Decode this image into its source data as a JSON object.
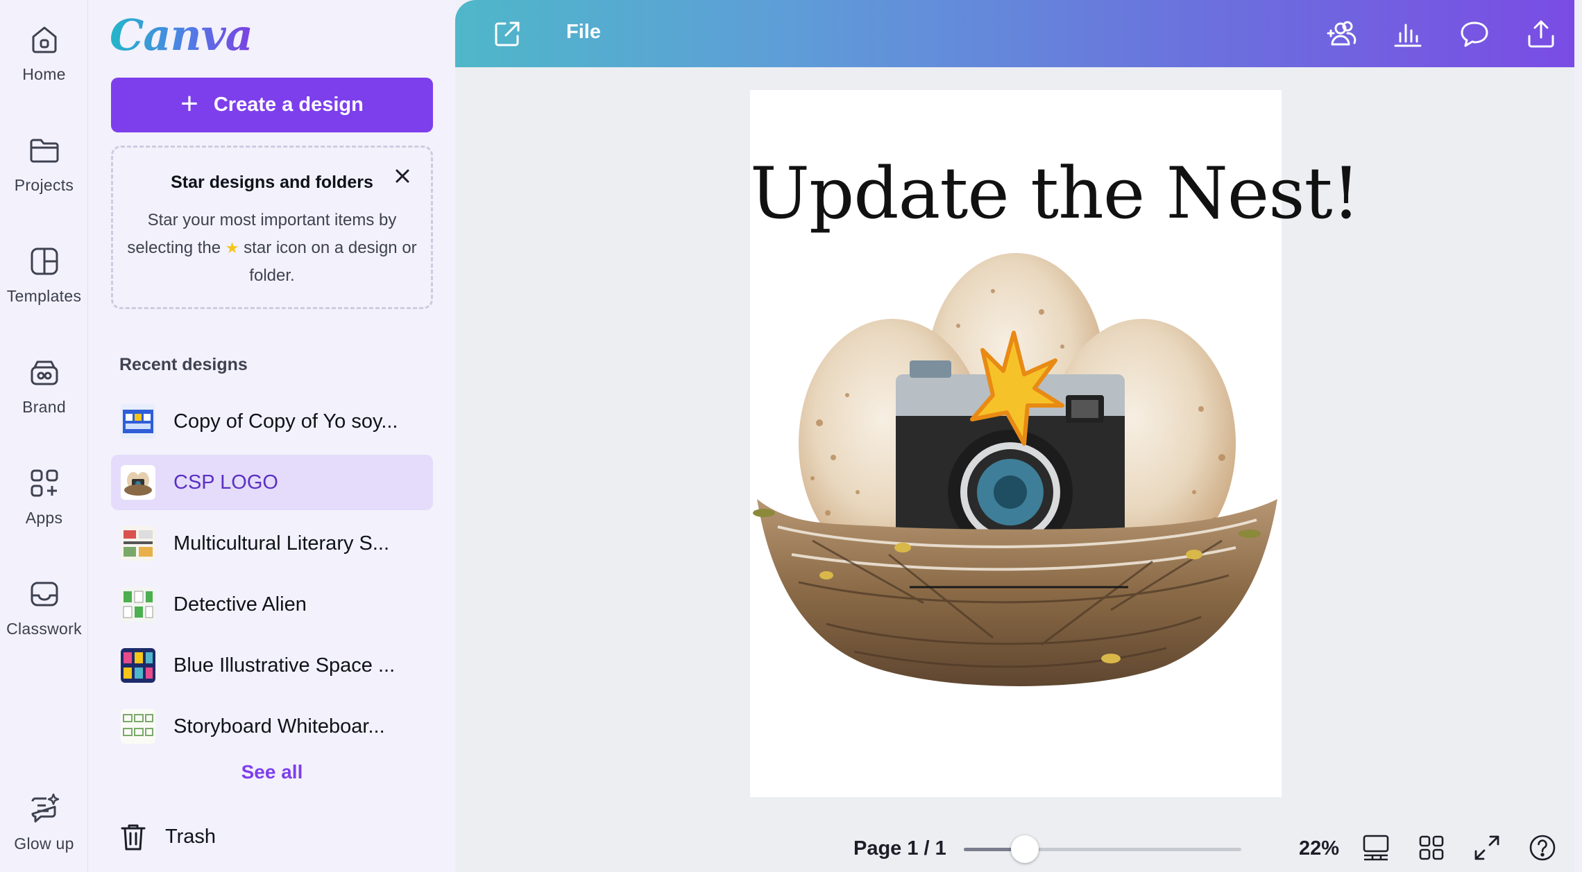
{
  "rail": {
    "items": [
      {
        "label": "Home",
        "icon": "home-icon"
      },
      {
        "label": "Projects",
        "icon": "folder-icon"
      },
      {
        "label": "Templates",
        "icon": "templates-icon"
      },
      {
        "label": "Brand",
        "icon": "brand-icon"
      },
      {
        "label": "Apps",
        "icon": "apps-icon"
      },
      {
        "label": "Classwork",
        "icon": "inbox-icon"
      },
      {
        "label": "Glow up",
        "icon": "glow-up-icon"
      }
    ]
  },
  "panel": {
    "logo": "Canva",
    "create_label": "Create a design",
    "tip": {
      "title": "Star designs and folders",
      "body_before": "Star your most important items by selecting the",
      "body_after": "star icon on a design or folder."
    },
    "recent_heading": "Recent designs",
    "recent": [
      {
        "name": "Copy of Copy of Yo soy..."
      },
      {
        "name": "CSP LOGO",
        "active": true
      },
      {
        "name": "Multicultural Literary S..."
      },
      {
        "name": "Detective Alien"
      },
      {
        "name": "Blue Illustrative Space ..."
      },
      {
        "name": "Storyboard Whiteboar..."
      }
    ],
    "see_all": "See all",
    "trash": "Trash"
  },
  "topbar": {
    "file_label": "File",
    "icons": [
      "external-link-icon",
      "add-people-icon",
      "insights-icon",
      "comment-icon",
      "share-icon"
    ]
  },
  "design": {
    "title": "Update the Nest!"
  },
  "bottombar": {
    "page_counter": "Page 1 / 1",
    "zoom": "22%",
    "zoom_fraction": 0.22,
    "icons": [
      "page-view-icon",
      "grid-view-icon",
      "fullscreen-icon",
      "help-icon"
    ]
  },
  "colors": {
    "accent": "#7d3fec",
    "active_bg": "#e4dcfa",
    "topbar_start": "#4fb7c9",
    "topbar_end": "#7a4ce4"
  }
}
